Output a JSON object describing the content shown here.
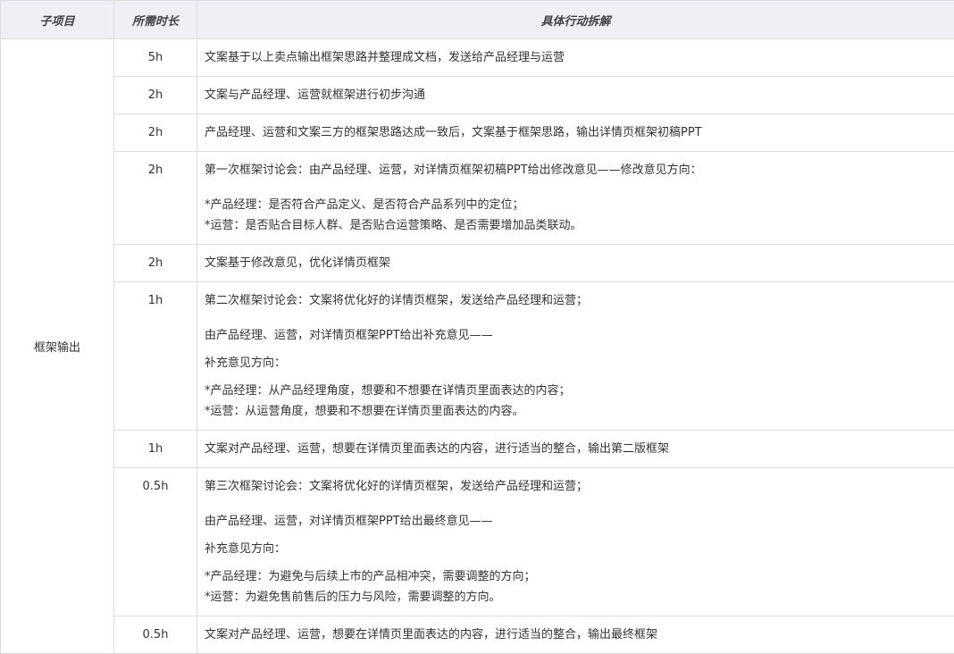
{
  "headers": {
    "sub_item": "子项目",
    "duration": "所需时长",
    "action": "具体行动拆解"
  },
  "group_label": "框架输出",
  "rows": [
    {
      "duration": "5h",
      "lines": [
        "文案基于以上卖点输出框架思路并整理成文档，发送给产品经理与运营"
      ]
    },
    {
      "duration": "2h",
      "lines": [
        "文案与产品经理、运营就框架进行初步沟通"
      ]
    },
    {
      "duration": "2h",
      "lines": [
        "产品经理、运营和文案三方的框架思路达成一致后，文案基于框架思路，输出详情页框架初稿PPT"
      ]
    },
    {
      "duration": "2h",
      "lines": [
        "第一次框架讨论会：由产品经理、运营，对详情页框架初稿PPT给出修改意见——修改意见方向：",
        "*产品经理：是否符合产品定义、是否符合产品系列中的定位；",
        "*运营：是否贴合目标人群、是否贴合运营策略、是否需要增加品类联动。"
      ]
    },
    {
      "duration": "2h",
      "lines": [
        "文案基于修改意见，优化详情页框架"
      ]
    },
    {
      "duration": "1h",
      "lines": [
        "第二次框架讨论会：文案将优化好的详情页框架，发送给产品经理和运营；",
        "由产品经理、运营，对详情页框架PPT给出补充意见——",
        "补充意见方向：",
        "*产品经理：从产品经理角度，想要和不想要在详情页里面表达的内容；",
        "*运营：从运营角度，想要和不想要在详情页里面表达的内容。"
      ]
    },
    {
      "duration": "1h",
      "lines": [
        "文案对产品经理、运营，想要在详情页里面表达的内容，进行适当的整合，输出第二版框架"
      ]
    },
    {
      "duration": "0.5h",
      "lines": [
        "第三次框架讨论会：文案将优化好的详情页框架，发送给产品经理和运营；",
        "由产品经理、运营，对详情页框架PPT给出最终意见——",
        "补充意见方向：",
        "*产品经理：为避免与后续上市的产品相冲突，需要调整的方向；",
        "*运营：为避免售前售后的压力与风险，需要调整的方向。"
      ]
    },
    {
      "duration": "0.5h",
      "lines": [
        "文案对产品经理、运营，想要在详情页里面表达的内容，进行适当的整合，输出最终框架"
      ]
    }
  ]
}
